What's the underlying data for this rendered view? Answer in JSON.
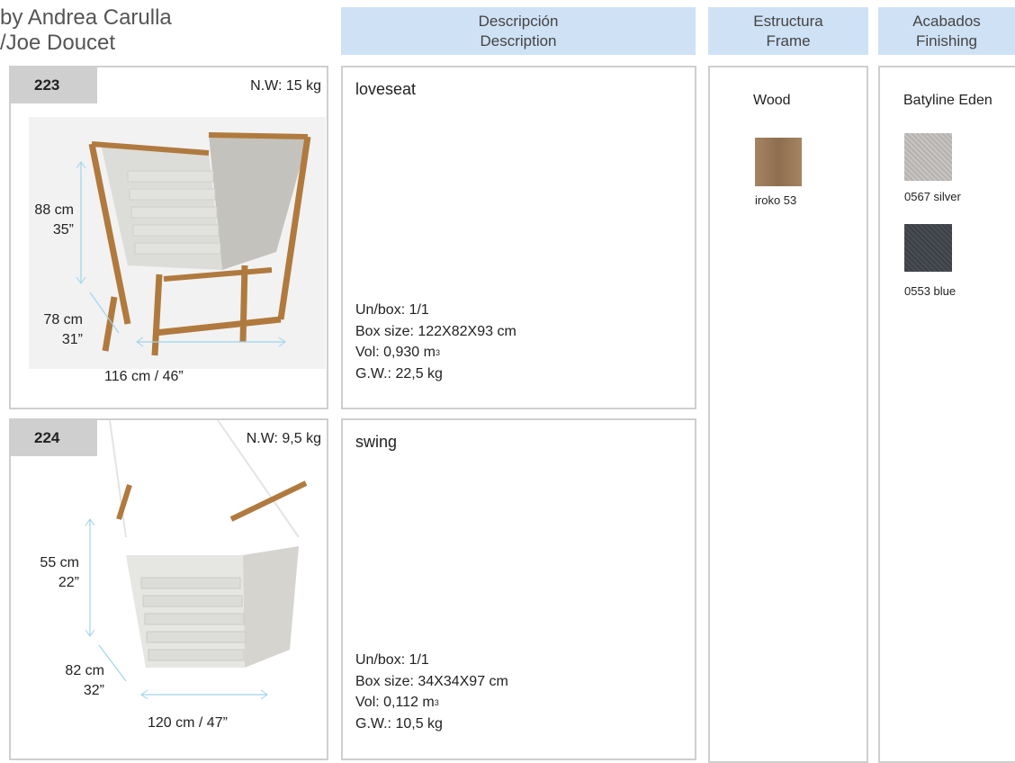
{
  "designer": {
    "line1": "by Andrea Carulla",
    "line2": "/Joe Doucet"
  },
  "headers": {
    "description": {
      "es": "Descripción",
      "en": "Description"
    },
    "frame": {
      "es": "Estructura",
      "en": "Frame"
    },
    "finishing": {
      "es": "Acabados",
      "en": "Finishing"
    }
  },
  "products": [
    {
      "code": "223",
      "net_weight": "N.W: 15 kg",
      "height": {
        "cm": "88 cm",
        "in": "35”"
      },
      "depth": {
        "cm": "78 cm",
        "in": "31”"
      },
      "width": "116 cm / 46”",
      "name": "loveseat",
      "units": "Un/box: 1/1",
      "box_size": "Box size: 122X82X93 cm",
      "volume": "Vol: 0,930 m",
      "volume_unit_sup": "3",
      "gross_weight": "G.W.: 22,5 kg"
    },
    {
      "code": "224",
      "net_weight": "N.W: 9,5 kg",
      "height": {
        "cm": "55 cm",
        "in": "22”"
      },
      "depth": {
        "cm": "82 cm",
        "in": "32”"
      },
      "width": "120 cm / 47”",
      "name": "swing",
      "units": "Un/box: 1/1",
      "box_size": "Box size: 34X34X97 cm",
      "volume": "Vol: 0,112 m",
      "volume_unit_sup": "3",
      "gross_weight": "G.W.: 10,5 kg"
    }
  ],
  "frame": {
    "material": "Wood",
    "swatches": [
      {
        "label": "iroko 53",
        "color": "#a48462"
      }
    ]
  },
  "finishing": {
    "material": "Batyline Eden",
    "swatches": [
      {
        "label": "0567 silver",
        "color": "#c8c5c2"
      },
      {
        "label": "0553 blue",
        "color": "#4a4d55"
      }
    ]
  }
}
